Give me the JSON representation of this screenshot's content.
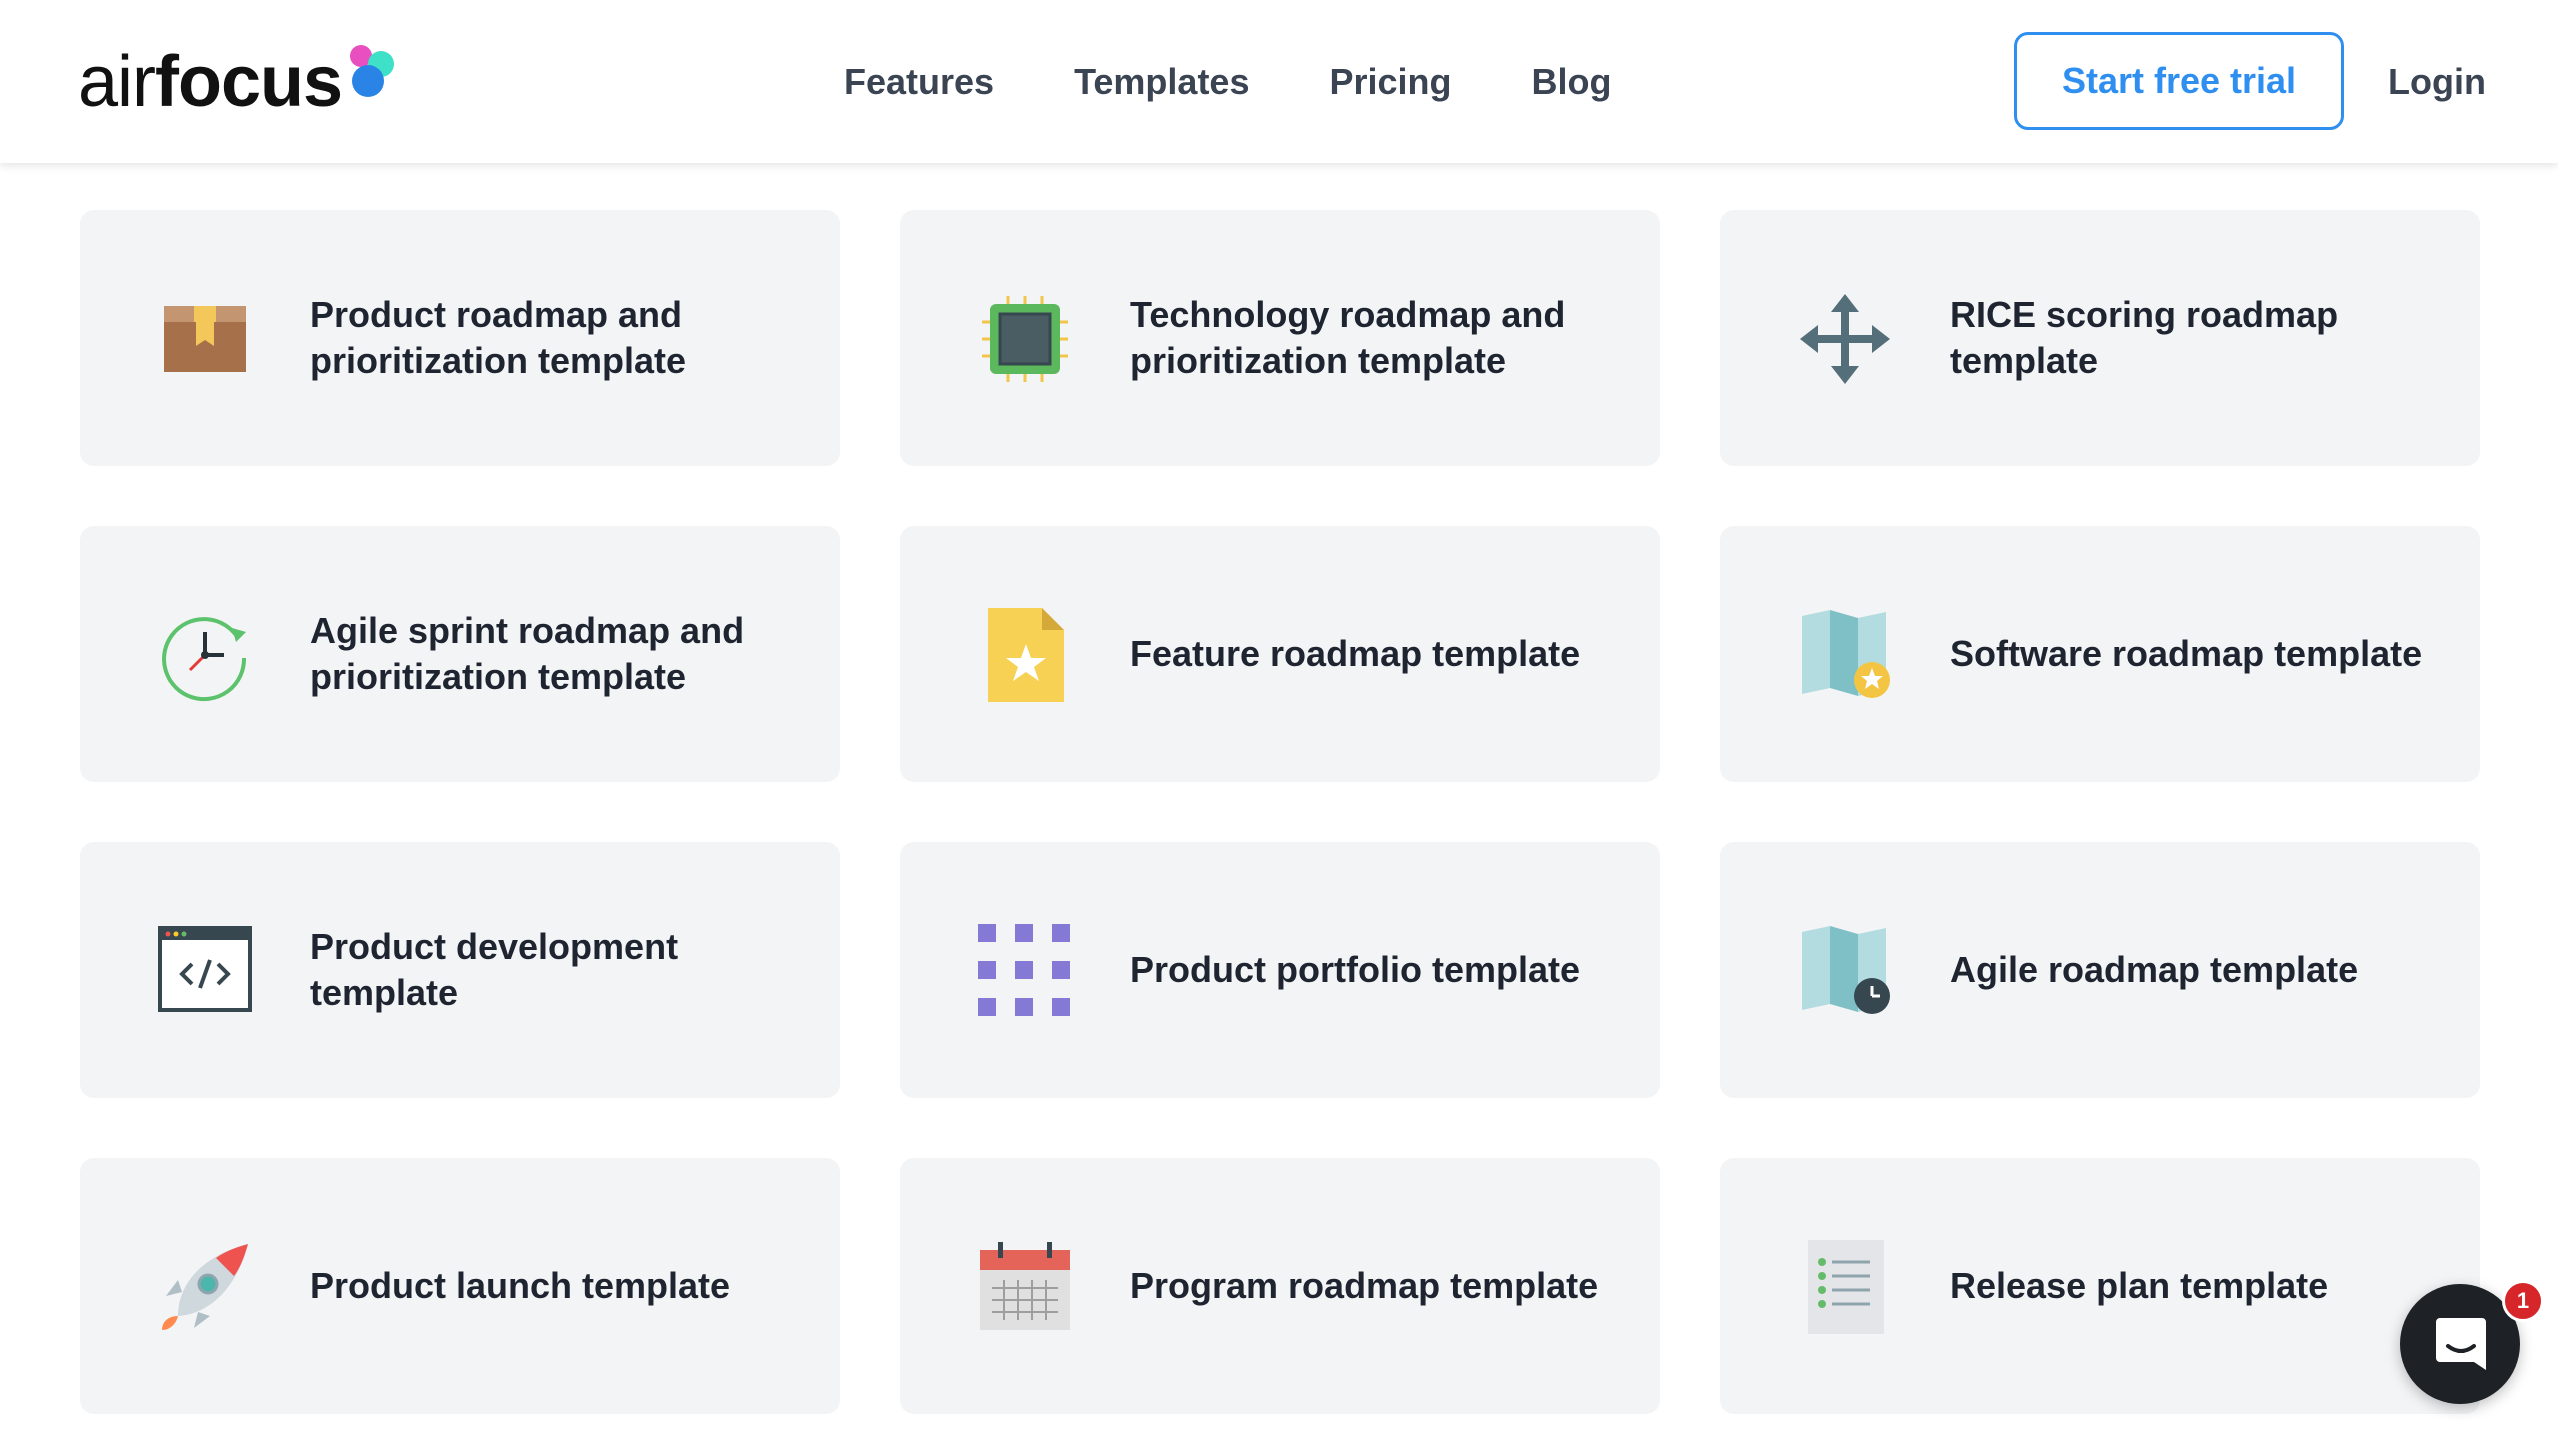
{
  "brand": {
    "logo_text_light": "air",
    "logo_text_bold": "focus"
  },
  "nav": {
    "items": [
      "Features",
      "Templates",
      "Pricing",
      "Blog"
    ]
  },
  "header_actions": {
    "trial_label": "Start free trial",
    "login_label": "Login"
  },
  "colors": {
    "accent": "#2f8ff0",
    "card_bg": "#f3f4f6",
    "logo_dots": [
      "#e84fbf",
      "#3fe0c8",
      "#2a84e6"
    ],
    "chat_bg": "#1e2226",
    "badge_bg": "#d6262a"
  },
  "templates": [
    {
      "title": "Product roadmap and prioritization template",
      "icon": "package-icon"
    },
    {
      "title": "Technology roadmap and prioritization template",
      "icon": "chip-icon"
    },
    {
      "title": "RICE scoring roadmap template",
      "icon": "move-arrows-icon"
    },
    {
      "title": "Agile sprint roadmap and prioritization template",
      "icon": "clock-cycle-icon"
    },
    {
      "title": "Feature roadmap template",
      "icon": "star-document-icon"
    },
    {
      "title": "Software roadmap template",
      "icon": "map-star-icon"
    },
    {
      "title": "Product development template",
      "icon": "code-window-icon"
    },
    {
      "title": "Product portfolio template",
      "icon": "grid-dots-icon"
    },
    {
      "title": "Agile roadmap template",
      "icon": "map-clock-icon"
    },
    {
      "title": "Product launch template",
      "icon": "rocket-icon"
    },
    {
      "title": "Program roadmap template",
      "icon": "calendar-icon"
    },
    {
      "title": "Release plan template",
      "icon": "checklist-icon"
    }
  ],
  "chat": {
    "badge_count": "1",
    "icon": "chat-bubble-icon"
  }
}
